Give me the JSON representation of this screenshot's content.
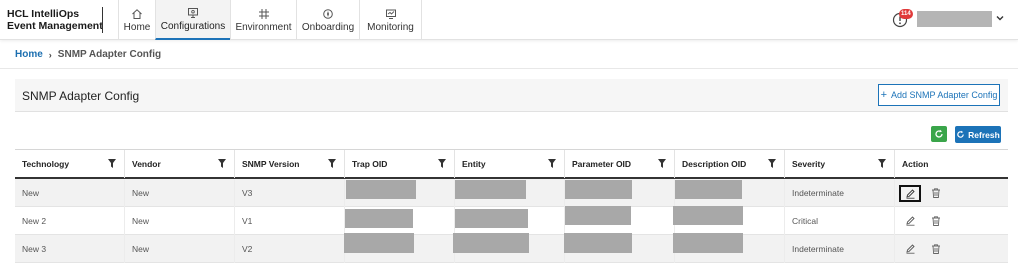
{
  "brand": {
    "line1": "HCL IntelliOps",
    "line2": "Event Management"
  },
  "nav": [
    {
      "label": "Home",
      "icon": "home-icon"
    },
    {
      "label": "Configurations",
      "icon": "config-icon",
      "active": true
    },
    {
      "label": "Environment",
      "icon": "environment-icon"
    },
    {
      "label": "Onboarding",
      "icon": "onboarding-icon"
    },
    {
      "label": "Monitoring",
      "icon": "monitoring-icon"
    }
  ],
  "notifications": {
    "count": "114",
    "icon": "info-alert-icon"
  },
  "breadcrumb": {
    "home": "Home",
    "current": "SNMP Adapter Config"
  },
  "panel": {
    "title": "SNMP Adapter Config",
    "add_button": "Add SNMP Adapter Config"
  },
  "toolbar": {
    "refresh_label": "Refresh",
    "sync_icon": "sync-icon"
  },
  "table": {
    "columns": [
      "Technology",
      "Vendor",
      "SNMP Version",
      "Trap OID",
      "Entity",
      "Parameter OID",
      "Description OID",
      "Severity",
      "Action"
    ],
    "rows": [
      {
        "technology": "New",
        "vendor": "New",
        "snmp_version": "V3",
        "severity": "Indeterminate"
      },
      {
        "technology": "New 2",
        "vendor": "New",
        "snmp_version": "V1",
        "severity": "Critical"
      },
      {
        "technology": "New 3",
        "vendor": "New",
        "snmp_version": "V2",
        "severity": "Indeterminate"
      }
    ]
  },
  "colors": {
    "accent": "#1c73b8",
    "success": "#3aa54a",
    "badge": "#e03a3a",
    "redaction": "#a8a8a8"
  }
}
